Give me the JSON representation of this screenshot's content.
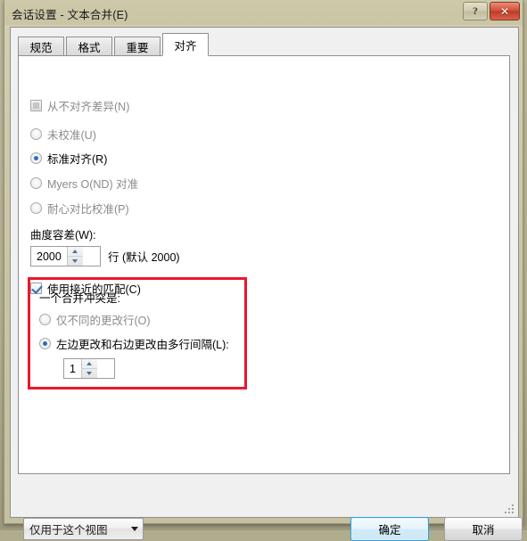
{
  "window": {
    "title": "会话设置 - 文本合并(E)",
    "help_button": "?",
    "close_button": "✕"
  },
  "tabs": [
    {
      "label": "规范",
      "active": false
    },
    {
      "label": "格式",
      "active": false
    },
    {
      "label": "重要",
      "active": false
    },
    {
      "label": "对齐",
      "active": true
    }
  ],
  "page": {
    "never_align_checkbox": {
      "label": "从不对齐差异(N)",
      "checked": false,
      "disabled": true
    },
    "alignment_radios": [
      {
        "label": "未校准(U)",
        "selected": false,
        "disabled": true
      },
      {
        "label": "标准对齐(R)",
        "selected": true,
        "disabled": false
      },
      {
        "label": "Myers O(ND) 对准",
        "selected": false,
        "disabled": true
      },
      {
        "label": "耐心对比校准(P)",
        "selected": false,
        "disabled": true
      }
    ],
    "tolerance": {
      "label": "曲度容差(W):",
      "value": "2000",
      "suffix": "行 (默认 2000)"
    },
    "approx_match_checkbox": {
      "label": "使用接近的匹配(C)",
      "checked": true
    },
    "conflict_group": {
      "title": "一个合并冲突是:",
      "border_color": "#e8192c",
      "options": [
        {
          "label": "仅不同的更改行(O)",
          "selected": false,
          "disabled": true
        },
        {
          "label": "左边更改和右边更改由多行间隔(L):",
          "selected": true,
          "disabled": false
        }
      ],
      "spacing_value": "1"
    }
  },
  "footer": {
    "scope_dropdown": {
      "value": "仅用于这个视图",
      "caret": "▼"
    },
    "ok_label": "确定",
    "cancel_label": "取消"
  }
}
